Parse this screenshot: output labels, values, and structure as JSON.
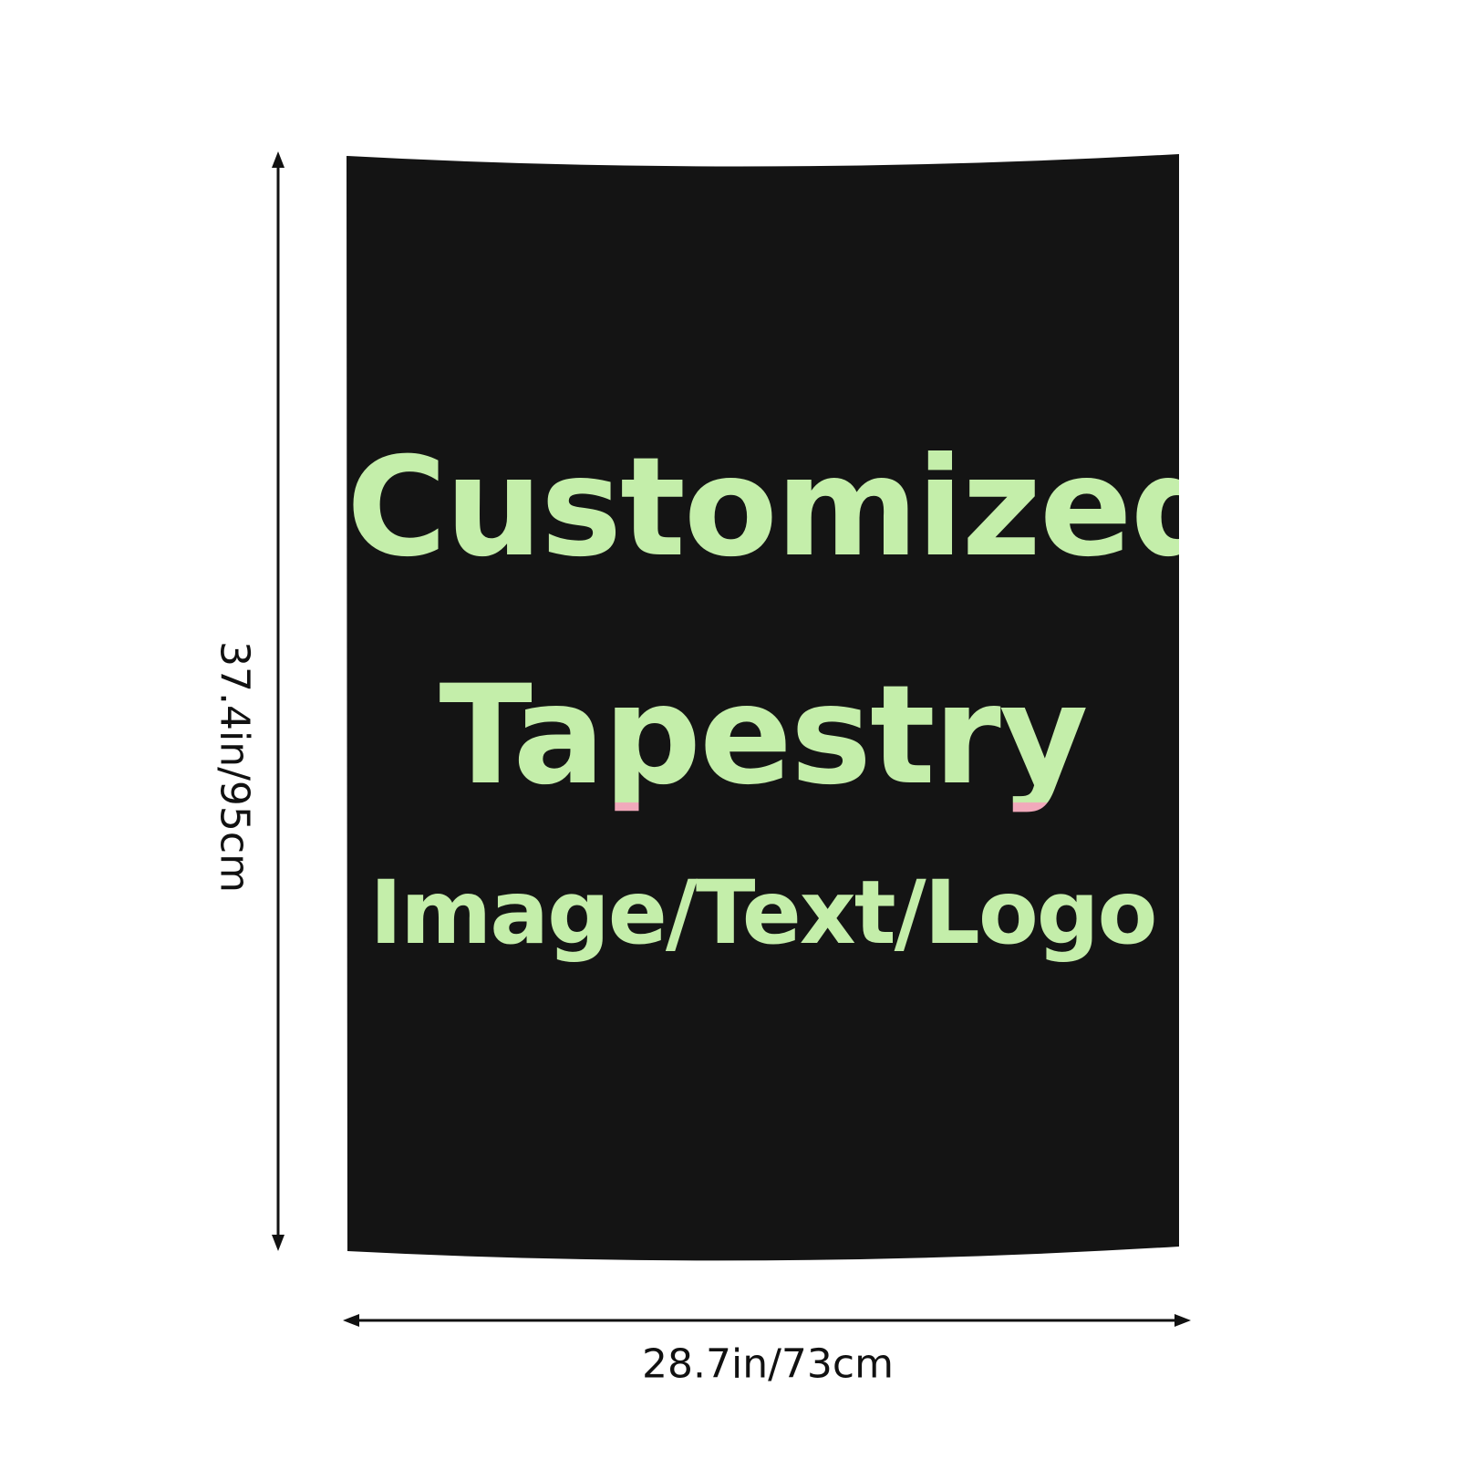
{
  "tapestry": {
    "lines": [
      "Customized",
      "Tapestry",
      "Image/Text/Logo"
    ],
    "background_color": "#141414",
    "text_gradient": [
      "#f1a9bb",
      "#e0c9b0",
      "#c4eeaa"
    ]
  },
  "dimensions": {
    "height": "37.4in/95cm",
    "width": "28.7in/73cm"
  }
}
